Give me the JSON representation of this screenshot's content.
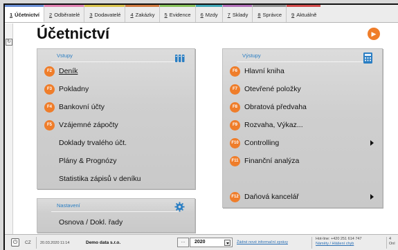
{
  "tabs": [
    {
      "num": "1",
      "label": "Účetnictví",
      "color": "#6a8fd6",
      "active": true
    },
    {
      "num": "2",
      "label": "Odběratelé",
      "color": "#e07fb0",
      "active": false
    },
    {
      "num": "3",
      "label": "Dodavatelé",
      "color": "#d8c14a",
      "active": false
    },
    {
      "num": "4",
      "label": "Zakázky",
      "color": "#d07a3f",
      "active": false
    },
    {
      "num": "5",
      "label": "Evidence",
      "color": "#86c15a",
      "active": false
    },
    {
      "num": "6",
      "label": "Mzdy",
      "color": "#3fa6b7",
      "active": false
    },
    {
      "num": "7",
      "label": "Sklady",
      "color": "#b06fb9",
      "active": false
    },
    {
      "num": "8",
      "label": "Správce",
      "color": "#8f8f8f",
      "active": false
    },
    {
      "num": "9",
      "label": "Aktuálně",
      "color": "#d14a4a",
      "active": false
    }
  ],
  "page_title": "Účetnictví",
  "vstupy": {
    "title": "Vstupy",
    "items": [
      {
        "key": "F2",
        "label": "Deník"
      },
      {
        "key": "F3",
        "label": "Pokladny"
      },
      {
        "key": "F4",
        "label": "Bankovní účty"
      },
      {
        "key": "F5",
        "label": "Vzájemné zápočty"
      },
      {
        "key": "",
        "label": "Doklady trvalého účt."
      },
      {
        "key": "",
        "label": "Plány & Prognózy"
      },
      {
        "key": "",
        "label": "Statistika zápisů v deníku"
      }
    ]
  },
  "nastaveni": {
    "title": "Nastavení",
    "items": [
      {
        "key": "",
        "label": "Osnova / Dokl. řady"
      }
    ]
  },
  "vystupy": {
    "title": "Výstupy",
    "items": [
      {
        "key": "F6",
        "label": "Hlavní kniha"
      },
      {
        "key": "F7",
        "label": "Otevřené položky"
      },
      {
        "key": "F8",
        "label": "Obratová předvaha"
      },
      {
        "key": "F9",
        "label": "Rozvaha, Výkaz..."
      },
      {
        "key": "F10",
        "label": "Controlling"
      },
      {
        "key": "F11",
        "label": "Finanční analýza"
      },
      {
        "key": "F12",
        "label": "Daňová kancelář"
      }
    ]
  },
  "status": {
    "lang": "CZ",
    "datetime": "20.03.2020 11:14",
    "company": "Demo data s.r.o.",
    "dots": "...",
    "year": "2020",
    "news": "Žádné nové informační zprávy",
    "hotline": "Hot-line: +420 251 614 747",
    "feedback": "Náměty / Hlášení chyb",
    "online_1": "4",
    "online_2": "Onl"
  },
  "colors": {
    "accent": "#ef7d2a",
    "link": "#2a7ec3"
  }
}
